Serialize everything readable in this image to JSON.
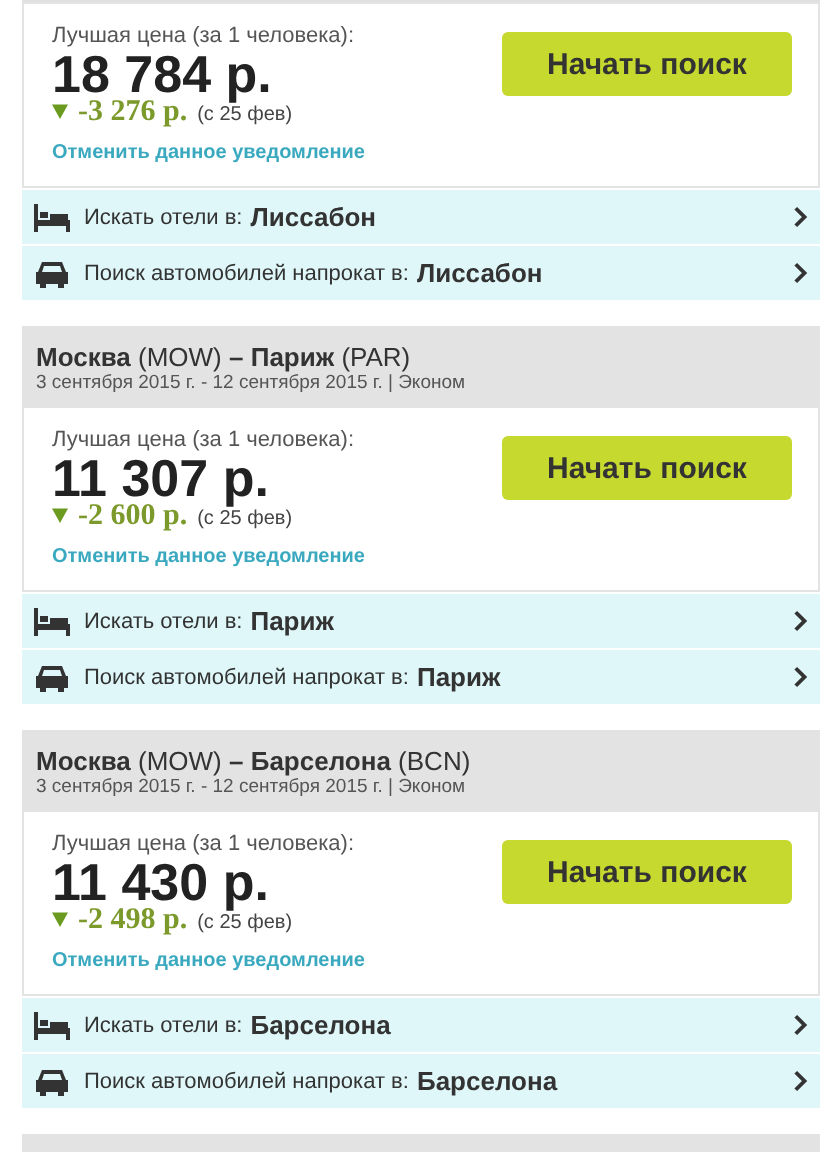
{
  "alerts": [
    {
      "price_label": "Лучшая цена (за 1 человека):",
      "price": "18 784 р.",
      "change": "-3 276 р.",
      "change_since": "(с 25 фев)",
      "cancel_link": "Отменить данное уведомление",
      "search_button": "Начать поиск",
      "offers": [
        {
          "kind": "hotel",
          "label": "Искать отели в:",
          "city": "Лиссабон"
        },
        {
          "kind": "car",
          "label": "Поиск автомобилей напрокат в:",
          "city": "Лиссабон"
        }
      ]
    },
    {
      "route": {
        "from": "Москва",
        "from_code": "(MOW)",
        "dash": "–",
        "to": "Париж",
        "to_code": "(PAR)"
      },
      "dates": "3 сентября 2015 г. - 12 сентября 2015 г. | Эконом",
      "price_label": "Лучшая цена (за 1 человека):",
      "price": "11 307 р.",
      "change": "-2 600 р.",
      "change_since": "(с 25 фев)",
      "cancel_link": "Отменить данное уведомление",
      "search_button": "Начать поиск",
      "offers": [
        {
          "kind": "hotel",
          "label": "Искать отели в:",
          "city": "Париж"
        },
        {
          "kind": "car",
          "label": "Поиск автомобилей напрокат в:",
          "city": "Париж"
        }
      ]
    },
    {
      "route": {
        "from": "Москва",
        "from_code": "(MOW)",
        "dash": "–",
        "to": "Барселона",
        "to_code": "(BCN)"
      },
      "dates": "3 сентября 2015 г. - 12 сентября 2015 г. | Эконом",
      "price_label": "Лучшая цена (за 1 человека):",
      "price": "11 430 р.",
      "change": "-2 498 р.",
      "change_since": "(с 25 фев)",
      "cancel_link": "Отменить данное уведомление",
      "search_button": "Начать поиск",
      "offers": [
        {
          "kind": "hotel",
          "label": "Искать отели в:",
          "city": "Барселона"
        },
        {
          "kind": "car",
          "label": "Поиск автомобилей напрокат в:",
          "city": "Барселона"
        }
      ]
    },
    {
      "kind": "cut_off"
    }
  ]
}
